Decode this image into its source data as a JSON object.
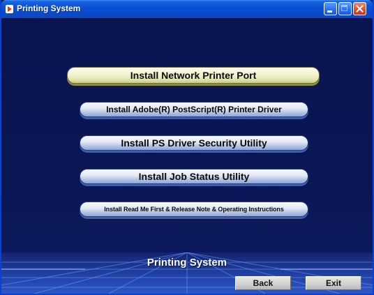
{
  "window": {
    "title": "Printing System"
  },
  "menu": {
    "items": [
      {
        "label": "Install Network Printer Port"
      },
      {
        "label": "Install Adobe(R) PostScript(R) Printer Driver"
      },
      {
        "label": "Install PS Driver Security Utility"
      },
      {
        "label": "Install Job Status Utility"
      },
      {
        "label": "Install Read Me First & Release Note & Operating Instructions"
      }
    ]
  },
  "footer": {
    "title": "Printing System",
    "back_label": "Back",
    "exit_label": "Exit"
  },
  "icons": {
    "app": "app-arrow-icon",
    "minimize": "minimize-icon",
    "maximize": "maximize-icon",
    "close": "close-icon"
  },
  "colors": {
    "titlebar": "#0a4fd4",
    "background": "#0a1450",
    "highlight_button": "#f0f2cc",
    "button": "#dfe7f6"
  }
}
